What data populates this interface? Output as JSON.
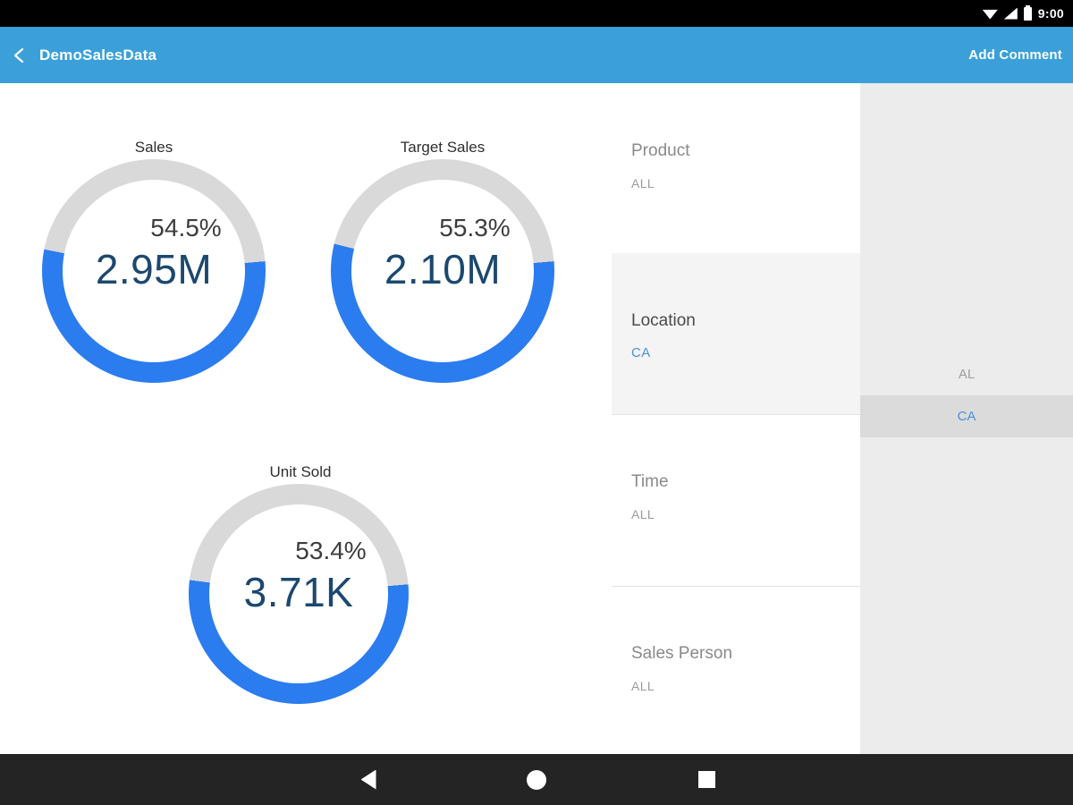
{
  "status_bar": {
    "time": "9:00"
  },
  "app_bar": {
    "title": "DemoSalesData",
    "action": "Add Comment"
  },
  "gauges": [
    {
      "title": "Sales",
      "percent": "54.5%",
      "percent_value": 54.5,
      "value": "2.95M"
    },
    {
      "title": "Target Sales",
      "percent": "55.3%",
      "percent_value": 55.3,
      "value": "2.10M"
    },
    {
      "title": "Unit Sold",
      "percent": "53.4%",
      "percent_value": 53.4,
      "value": "3.71K"
    }
  ],
  "filters": [
    {
      "label": "Product",
      "value": "ALL",
      "selected": false
    },
    {
      "label": "Location",
      "value": "CA",
      "selected": true
    },
    {
      "label": "Time",
      "value": "ALL",
      "selected": false
    },
    {
      "label": "Sales Person",
      "value": "ALL",
      "selected": false
    }
  ],
  "options": [
    {
      "label": "AL",
      "selected": false
    },
    {
      "label": "CA",
      "selected": true
    }
  ],
  "colors": {
    "appbar_blue": "#3BA0D9",
    "accent_blue": "#2B7CEF",
    "link_blue": "#4A90D9",
    "value_navy": "#1C486F",
    "ring_gray": "#D9D9D9"
  },
  "chart_data": [
    {
      "type": "gauge",
      "title": "Sales",
      "percent": 54.5,
      "value_label": "2.95M"
    },
    {
      "type": "gauge",
      "title": "Target Sales",
      "percent": 55.3,
      "value_label": "2.10M"
    },
    {
      "type": "gauge",
      "title": "Unit Sold",
      "percent": 53.4,
      "value_label": "3.71K"
    }
  ]
}
